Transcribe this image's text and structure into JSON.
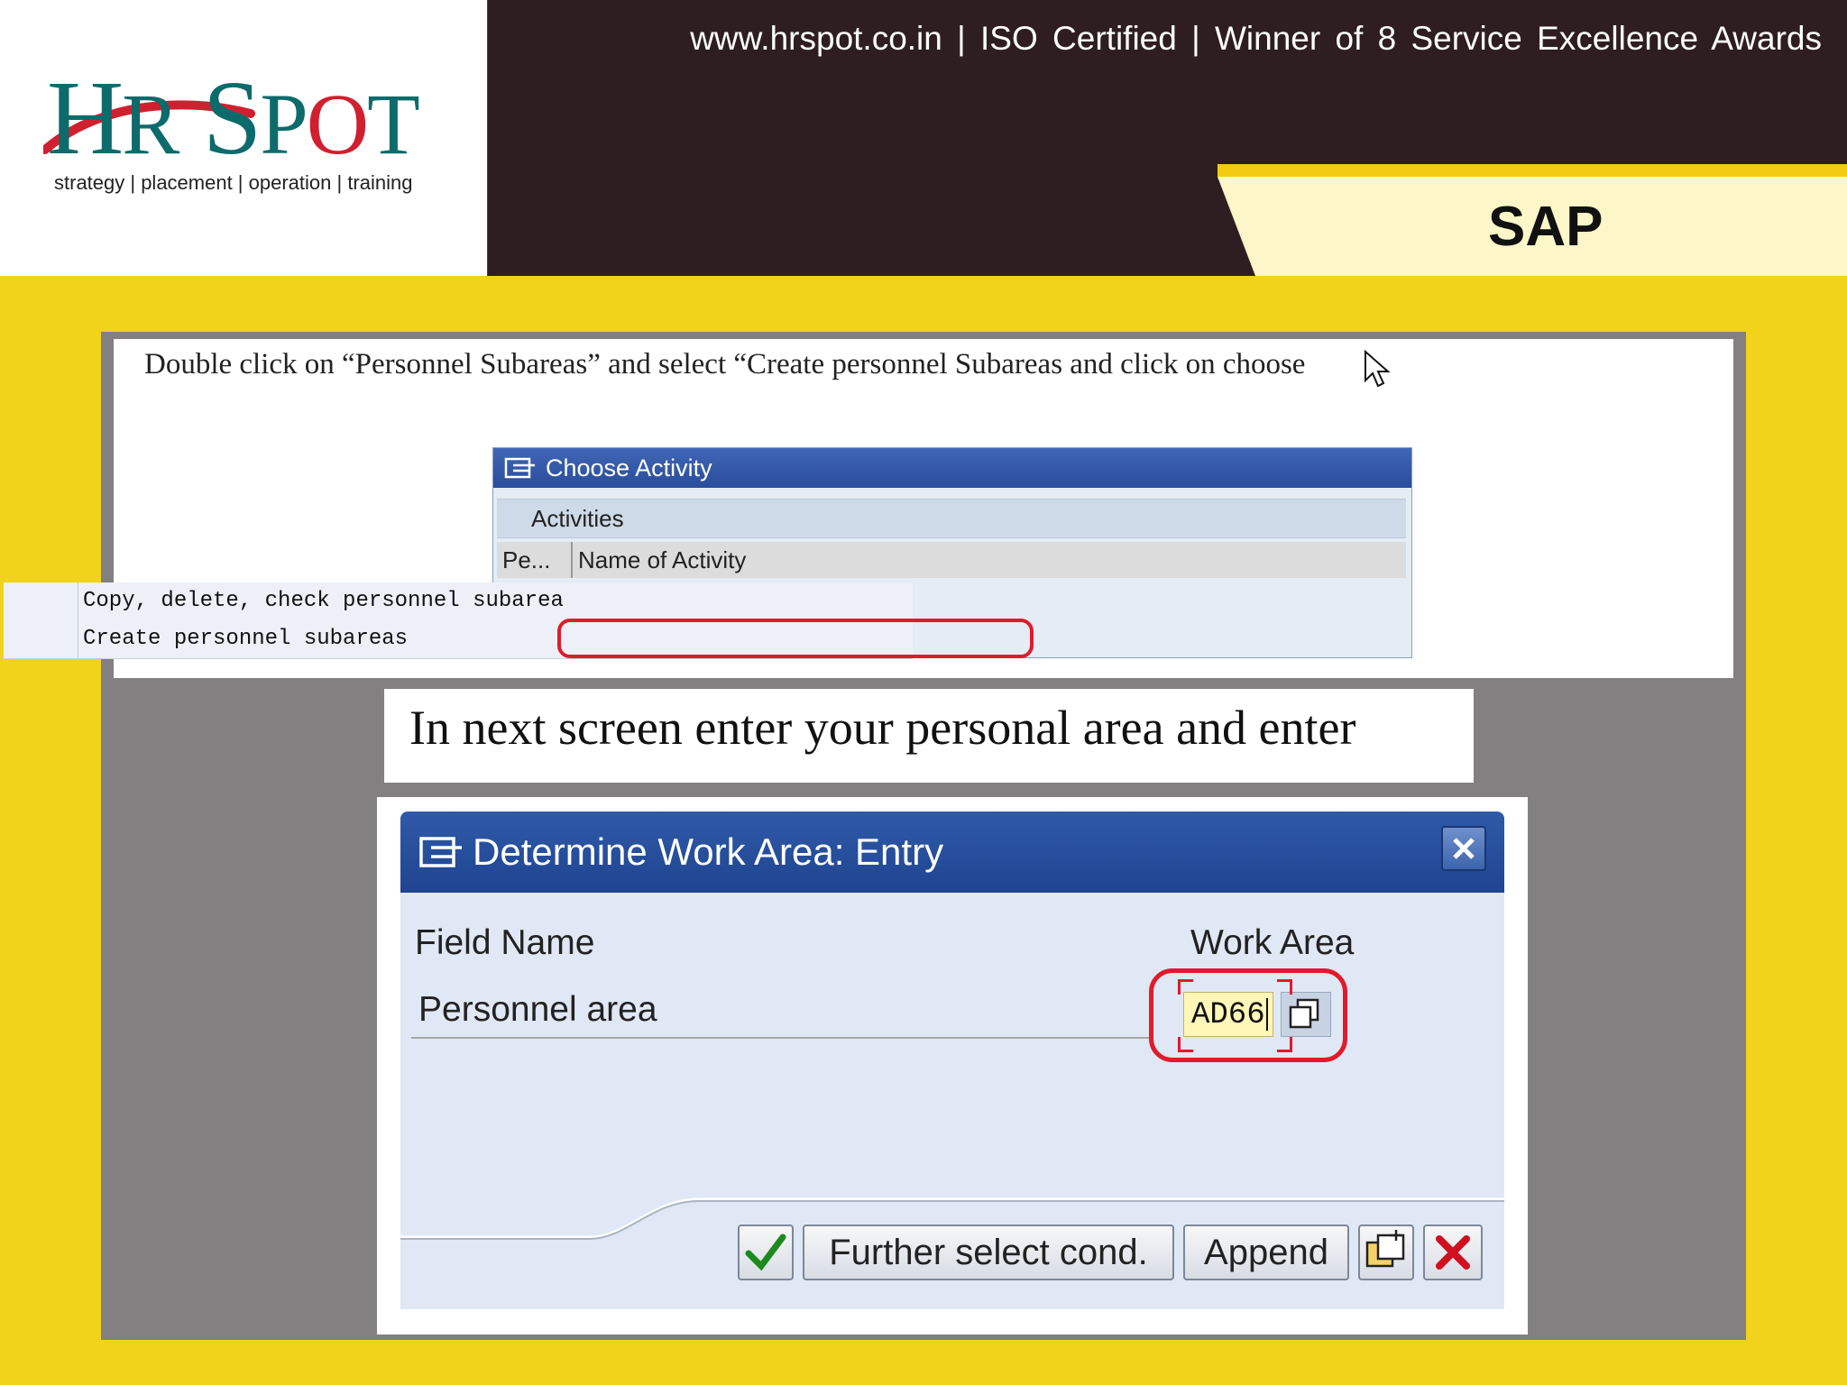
{
  "header": {
    "logo_text": "HR SPOT",
    "logo_tagline": "strategy | placement | operation | training",
    "top_line": "www.hrspot.co.in  |  ISO Certified  |  Winner of 8 Service Excellence Awards",
    "section_label": "SAP",
    "accent_color": "#f1cc12",
    "dark_bg": "#2f1e21"
  },
  "step1": {
    "instruction": "Double click on “Personnel Subareas” and select “Create personnel Subareas and click on choose"
  },
  "choose_activity": {
    "title": "Choose Activity",
    "section_header": "Activities",
    "columns": [
      "Pe...",
      "Name of Activity"
    ],
    "rows": [
      {
        "activity": "Copy, delete, check personnel subarea"
      },
      {
        "activity": "Create personnel subareas"
      }
    ]
  },
  "step2": {
    "instruction": "In next screen enter your personal area and enter"
  },
  "work_area_dialog": {
    "title": "Determine Work Area: Entry",
    "field_name_header": "Field Name",
    "work_area_header": "Work Area",
    "field_label": "Personnel area",
    "field_value": "AD66",
    "buttons": {
      "ok_icon": "check-icon",
      "further_select": "Further select cond.",
      "append": "Append",
      "new_icon": "new-entries-icon",
      "cancel_icon": "cancel-icon"
    }
  },
  "highlight_color": "#e11a2c"
}
